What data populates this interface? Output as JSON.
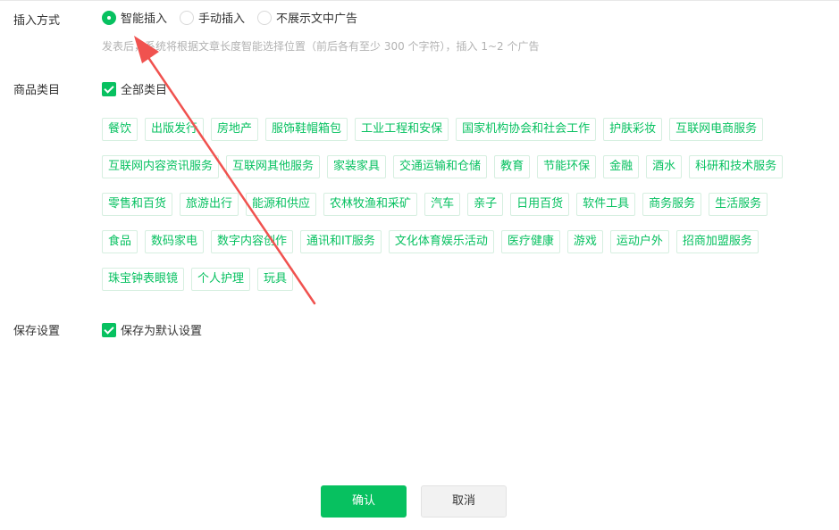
{
  "insert_mode": {
    "label": "插入方式",
    "options": [
      "智能插入",
      "手动插入",
      "不展示文中广告"
    ],
    "selected_index": 0,
    "hint": "发表后，系统将根据文章长度智能选择位置（前后各有至少 300 个字符），插入 1~2 个广告"
  },
  "category": {
    "label": "商品类目",
    "all_label": "全部类目",
    "all_checked": true,
    "tags": [
      "餐饮",
      "出版发行",
      "房地产",
      "服饰鞋帽箱包",
      "工业工程和安保",
      "国家机构协会和社会工作",
      "护肤彩妆",
      "互联网电商服务",
      "互联网内容资讯服务",
      "互联网其他服务",
      "家装家具",
      "交通运输和仓储",
      "教育",
      "节能环保",
      "金融",
      "酒水",
      "科研和技术服务",
      "零售和百货",
      "旅游出行",
      "能源和供应",
      "农林牧渔和采矿",
      "汽车",
      "亲子",
      "日用百货",
      "软件工具",
      "商务服务",
      "生活服务",
      "食品",
      "数码家电",
      "数字内容创作",
      "通讯和IT服务",
      "文化体育娱乐活动",
      "医疗健康",
      "游戏",
      "运动户外",
      "招商加盟服务",
      "珠宝钟表眼镜",
      "个人护理",
      "玩具"
    ]
  },
  "save_settings": {
    "label": "保存设置",
    "default_label": "保存为默认设置",
    "checked": true
  },
  "buttons": {
    "confirm": "确认",
    "cancel": "取消"
  },
  "colors": {
    "accent": "#07c160",
    "annotation_arrow": "#f0524f"
  }
}
